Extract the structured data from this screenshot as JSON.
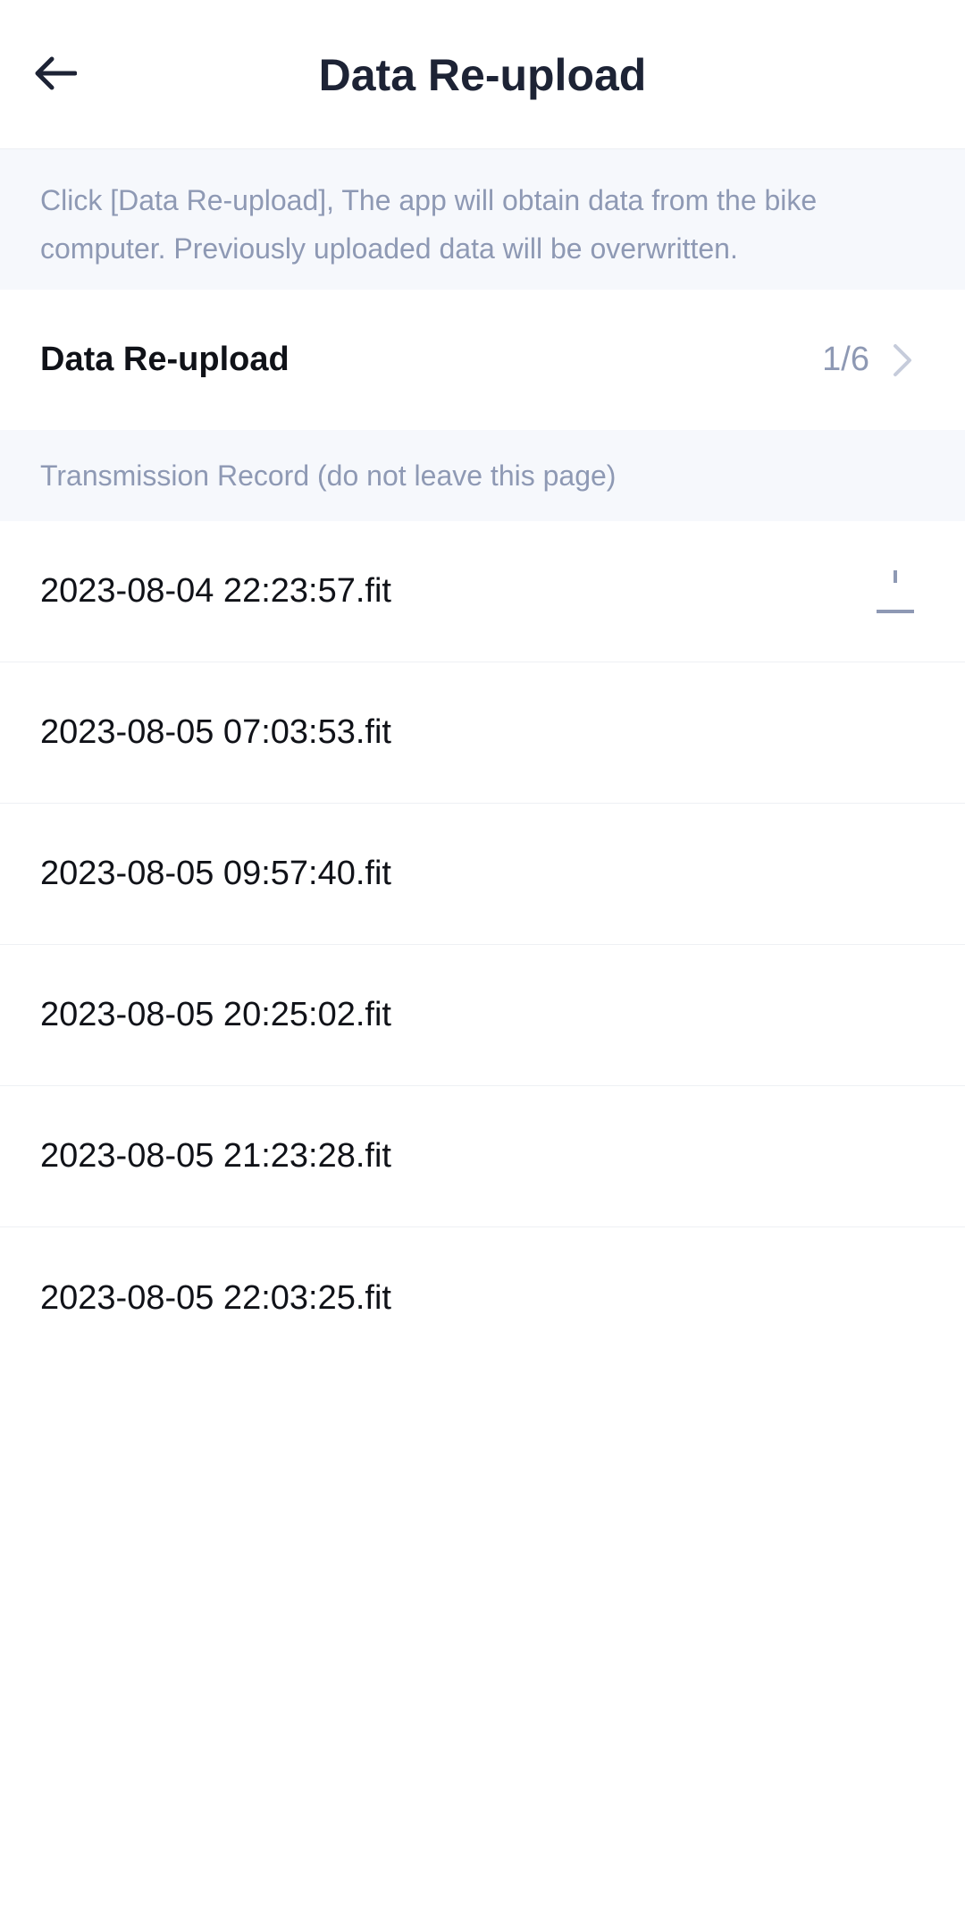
{
  "header": {
    "title": "Data Re-upload",
    "back_icon": "arrow-left-icon"
  },
  "notice": {
    "text": "Click [Data Re-upload], The app will obtain data from the bike computer. Previously uploaded data will be overwritten."
  },
  "reupload": {
    "label": "Data Re-upload",
    "count": "1/6",
    "chevron_icon": "chevron-right-icon"
  },
  "records": {
    "section_title": "Transmission Record (do not leave this page)",
    "items": [
      {
        "name": "2023-08-04 22:23:57.fit",
        "status_icon": "upload-progress-icon"
      },
      {
        "name": "2023-08-05 07:03:53.fit"
      },
      {
        "name": "2023-08-05 09:57:40.fit"
      },
      {
        "name": "2023-08-05 20:25:02.fit"
      },
      {
        "name": "2023-08-05 21:23:28.fit"
      },
      {
        "name": "2023-08-05 22:03:25.fit"
      }
    ]
  },
  "colors": {
    "title": "#1d2335",
    "muted": "#8e99b4",
    "banner_bg": "#f6f8fc",
    "text": "#101218"
  }
}
